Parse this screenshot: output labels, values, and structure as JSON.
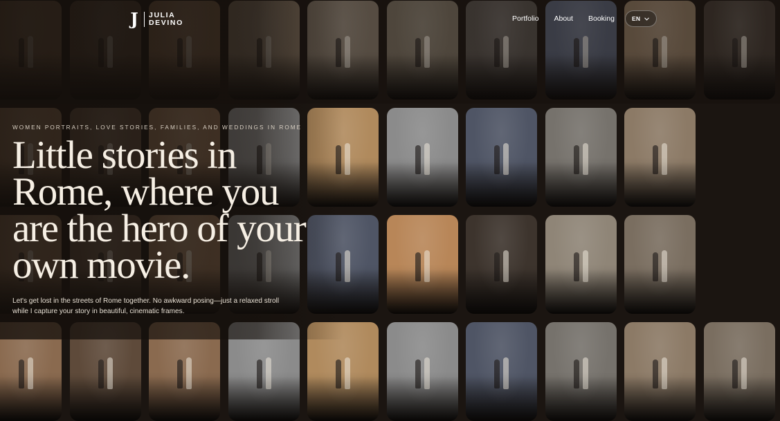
{
  "brand": {
    "mark": "J",
    "name_line1": "JULIA",
    "name_line2": "DEVINO"
  },
  "nav": {
    "links": [
      "Portfolio",
      "About",
      "Booking"
    ],
    "language": "EN"
  },
  "hero": {
    "eyebrow": "WOMEN PORTRAITS, LOVE STORIES, FAMILIES, AND WEDDINGS IN ROME",
    "headline": "Little stories in Rome, where you are the hero of your own movie.",
    "subtext": "Let's get lost in the streets of Rome together. No awkward posing—just a relaxed stroll while I capture your story in beautiful, cinematic frames."
  },
  "gallery": {
    "rows": [
      [
        "colosseum-warm",
        "beach-sunset",
        "colosseum-warm",
        "couple-street",
        "fountain-couple",
        "street-walk",
        "bride-dark",
        "beach-dusk",
        "colosseum-couple",
        "arcade-dark"
      ],
      [
        "colosseum-warm",
        "beach-sunset",
        "colosseum-warm",
        "street-bw",
        "beach-sunset-bright",
        "street-bw",
        "beach-dusk",
        "bride-bridge",
        "couple-street"
      ],
      [
        "colosseum-warm",
        "beach-sunset",
        "colosseum-warm",
        "steps-bw",
        "beach-dusk",
        "colosseum-bright",
        "arcade-dark",
        "trevi-couple",
        "fountain-couple"
      ],
      [
        "colosseum-warm",
        "beach-sunset",
        "colosseum-warm",
        "street-bw",
        "beach-sunset-bright",
        "street-bw",
        "beach-dusk",
        "bride-bridge",
        "couple-street",
        "fountain-couple"
      ]
    ],
    "palette": {
      "colosseum-warm": "#8a6a4f",
      "colosseum-bright": "#b88658",
      "colosseum-couple": "#7e6a55",
      "beach-sunset": "#5e4a3a",
      "beach-sunset-bright": "#b08a5d",
      "beach-dusk": "#4f5565",
      "couple-street": "#8c7a66",
      "fountain-couple": "#7a6e60",
      "street-walk": "#6f6557",
      "bride-dark": "#4e4843",
      "arcade-dark": "#3d342d",
      "street-bw": "#8b8b8b",
      "steps-bw": "#7d7d7d",
      "bride-bridge": "#76726c",
      "trevi-couple": "#8f8577"
    }
  }
}
